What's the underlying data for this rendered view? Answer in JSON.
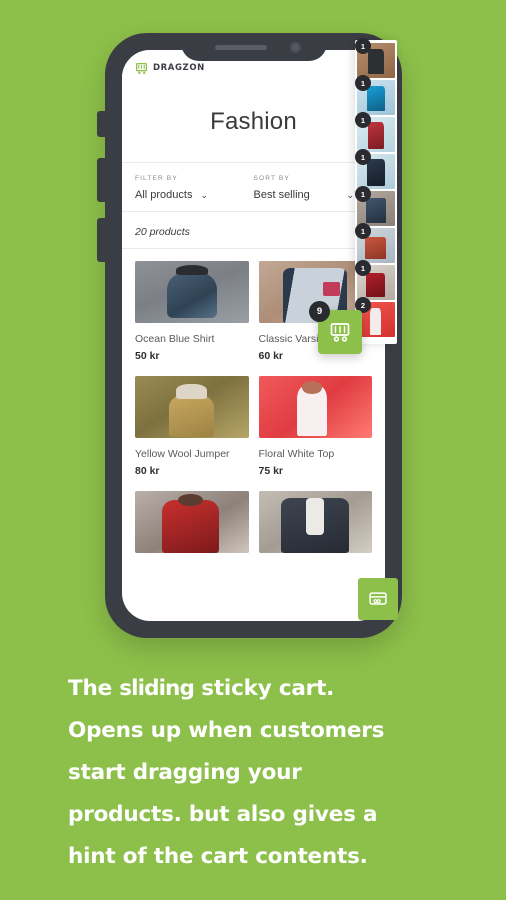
{
  "background_color": "#8dc04a",
  "accent_color": "#8dc04a",
  "badge_color": "#2a2b30",
  "phone": {
    "app": {
      "logo_text": "DRAGZON",
      "logo_icon": "shopping-cart-icon",
      "menu_icon": "hamburger-menu-icon",
      "page_title": "Fashion"
    },
    "filters": {
      "filter_label": "FILTER BY",
      "filter_value": "All products",
      "sort_label": "SORT BY",
      "sort_value": "Best selling",
      "caret_icon": "chevron-down-icon",
      "product_count": "20 products"
    },
    "products": [
      {
        "name": "Ocean Blue Shirt",
        "price": "50 kr",
        "photo": "ph1"
      },
      {
        "name": "Classic Varsity Top",
        "price": "60 kr",
        "photo": "ph2"
      },
      {
        "name": "Yellow Wool Jumper",
        "price": "80 kr",
        "photo": "ph3"
      },
      {
        "name": "Floral White Top",
        "price": "75 kr",
        "photo": "ph4"
      },
      {
        "name": "",
        "price": "",
        "photo": "ph5"
      },
      {
        "name": "",
        "price": "",
        "photo": "ph6"
      }
    ],
    "drag_cart": {
      "icon": "shopping-cart-icon",
      "count": "9"
    },
    "sticky_cart": {
      "items": [
        {
          "qty": "1",
          "thumb": "t1"
        },
        {
          "qty": "1",
          "thumb": "t2"
        },
        {
          "qty": "1",
          "thumb": "t3"
        },
        {
          "qty": "1",
          "thumb": "t4"
        },
        {
          "qty": "1",
          "thumb": "t5"
        },
        {
          "qty": "1",
          "thumb": "t6"
        },
        {
          "qty": "1",
          "thumb": "t7"
        },
        {
          "qty": "2",
          "thumb": "t8"
        }
      ]
    },
    "checkout_button": {
      "icon": "credit-card-checkout-icon"
    }
  },
  "caption": {
    "line1_a": "The ",
    "line1_em": "sliding",
    "line1_b": " sticky cart.",
    "line2": "Opens up when customers",
    "line3": "start dragging your",
    "line4": "products. but also gives a",
    "line5": "hint of the cart contents."
  }
}
